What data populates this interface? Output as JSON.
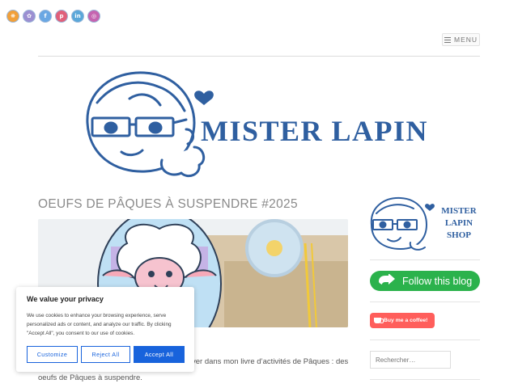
{
  "social": [
    {
      "name": "rss",
      "bg": "#f1a03a",
      "glyph": "❋"
    },
    {
      "name": "pinterest-alt",
      "bg": "#9b8fd1",
      "glyph": "✿"
    },
    {
      "name": "facebook",
      "bg": "#6aa7e3",
      "glyph": "f"
    },
    {
      "name": "pinterest",
      "bg": "#e0607a",
      "glyph": "p"
    },
    {
      "name": "linkedin",
      "bg": "#5aa7d9",
      "glyph": "in"
    },
    {
      "name": "instagram",
      "bg": "#c564b0",
      "glyph": "◎"
    }
  ],
  "header": {
    "menu_label": "MENU",
    "logo_text": "MISTER LAPIN"
  },
  "post": {
    "title": "OEUFS DE PÂQUES À SUSPENDRE #2025",
    "excerpt_line1": "ver dans mon livre d’activités de Pâques : des",
    "excerpt_line2": "oeufs de Pâques à suspendre."
  },
  "sidebar": {
    "shop_line1": "MISTER",
    "shop_line2": "LAPIN",
    "shop_line3": "SHOP",
    "follow_label": "Follow this blog",
    "coffee_label": "Buy me a coffee!",
    "search_placeholder": "Rechercher…"
  },
  "cookie": {
    "title": "We value your privacy",
    "text": "We use cookies to enhance your browsing experience, serve personalized ads or content, and analyze our traffic. By clicking \"Accept All\", you consent to our use of cookies.",
    "customize": "Customize",
    "reject": "Reject All",
    "accept": "Accept All"
  },
  "colors": {
    "brand_blue": "#2f5fa0",
    "follow_green": "#2bb24c",
    "coffee_red": "#ff5e5b",
    "cookie_blue": "#1863dc"
  }
}
